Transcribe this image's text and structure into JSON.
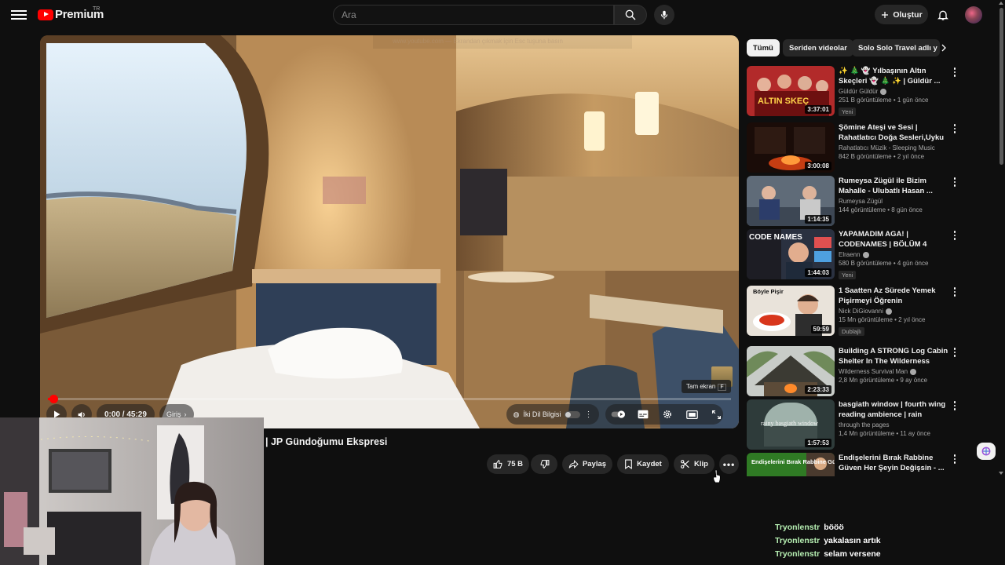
{
  "header": {
    "logo_text": "Premium",
    "country": "TR",
    "search_placeholder": "Ara",
    "create_label": "Oluştur"
  },
  "player": {
    "watermark": "www.youtube.com — Ekrandan çıkmak için Esc tuşuna basın",
    "fullscreen_tip": "Tam ekran",
    "fullscreen_key": "F",
    "time": "0:00 / 45:29",
    "chapter": "Giriş",
    "dub_label": "İki Dil Bilgisi",
    "progress": 0.003
  },
  "video": {
    "title": "| JP Gündoğumu Ekspresi",
    "likes": "75 B",
    "share": "Paylaş",
    "save": "Kaydet",
    "clip": "Klip"
  },
  "chips": [
    "Tümü",
    "Seriden videolar",
    "Solo Solo Travel adlı y"
  ],
  "recommendations": [
    {
      "title": "✨ 🎄 👻 Yılbaşının Altın Skeçleri 👻 🎄 ✨ | Güldür ...",
      "channel": "Güldür Güldür",
      "verified": true,
      "meta": "251 B görüntüleme • 1 gün önce",
      "badge": "Yeni",
      "duration": "3:37:01"
    },
    {
      "title": "Şömine Ateşi ve Sesi | Rahatlatıcı Doğa Sesleri,Uyku ...",
      "channel": "Rahatlatıcı Müzik - Sleeping Music",
      "verified": false,
      "meta": "842 B görüntüleme • 2 yıl önce",
      "badge": "",
      "duration": "3:00:08"
    },
    {
      "title": "Rumeysa Zügül ile Bizim Mahalle - Ulubatlı Hasan ...",
      "channel": "Rumeysa Zügül",
      "verified": false,
      "meta": "144 görüntüleme • 8 gün önce",
      "badge": "",
      "duration": "1:14:35"
    },
    {
      "title": "YAPAMADIM AGA! | CODENAMES | BÖLÜM 4",
      "channel": "Elraenn",
      "verified": true,
      "meta": "580 B görüntüleme • 4 gün önce",
      "badge": "Yeni",
      "duration": "1:44:03"
    },
    {
      "title": "1 Saatten Az Sürede Yemek Pişirmeyi Öğrenin",
      "channel": "Nick DiGiovanni",
      "verified": true,
      "meta": "15 Mn görüntüleme • 2 yıl önce",
      "badge": "Dublajlı",
      "duration": "59:59"
    },
    {
      "title": "Building A STRONG Log Cabin Shelter In The Wilderness",
      "channel": "Wilderness Survival Man",
      "verified": true,
      "meta": "2,8 Mn görüntüleme • 9 ay önce",
      "badge": "",
      "duration": "2:23:33"
    },
    {
      "title": "basgiath window | fourth wing reading ambience | rain sounds",
      "channel": "through the pages",
      "verified": false,
      "meta": "1,4 Mn görüntüleme • 11 ay önce",
      "badge": "",
      "duration": "1:57:53"
    },
    {
      "title": "Endişelerini Bırak Rabbine Güven Her Şeyin Değişsin - ...",
      "channel": "",
      "verified": false,
      "meta": "",
      "badge": "",
      "duration": ""
    }
  ],
  "thumb_text": {
    "t1": "ALTIN SKEÇ",
    "t4": "CODE NAMES",
    "t5": "Böyle Pişir",
    "t7": "rainy basgiath window",
    "t8": "Endişelerini Bırak Rabbine Güven Her Şeyin"
  },
  "chat": [
    {
      "user": "Tryonlenstr",
      "message": "bööö"
    },
    {
      "user": "Tryonlenstr",
      "message": "yakalasın artık"
    },
    {
      "user": "Tryonlenstr",
      "message": "selam versene"
    }
  ],
  "colors": {
    "accent": "#ff0000",
    "chat_user": "#b7f0b3",
    "background": "#0f0f0f"
  }
}
